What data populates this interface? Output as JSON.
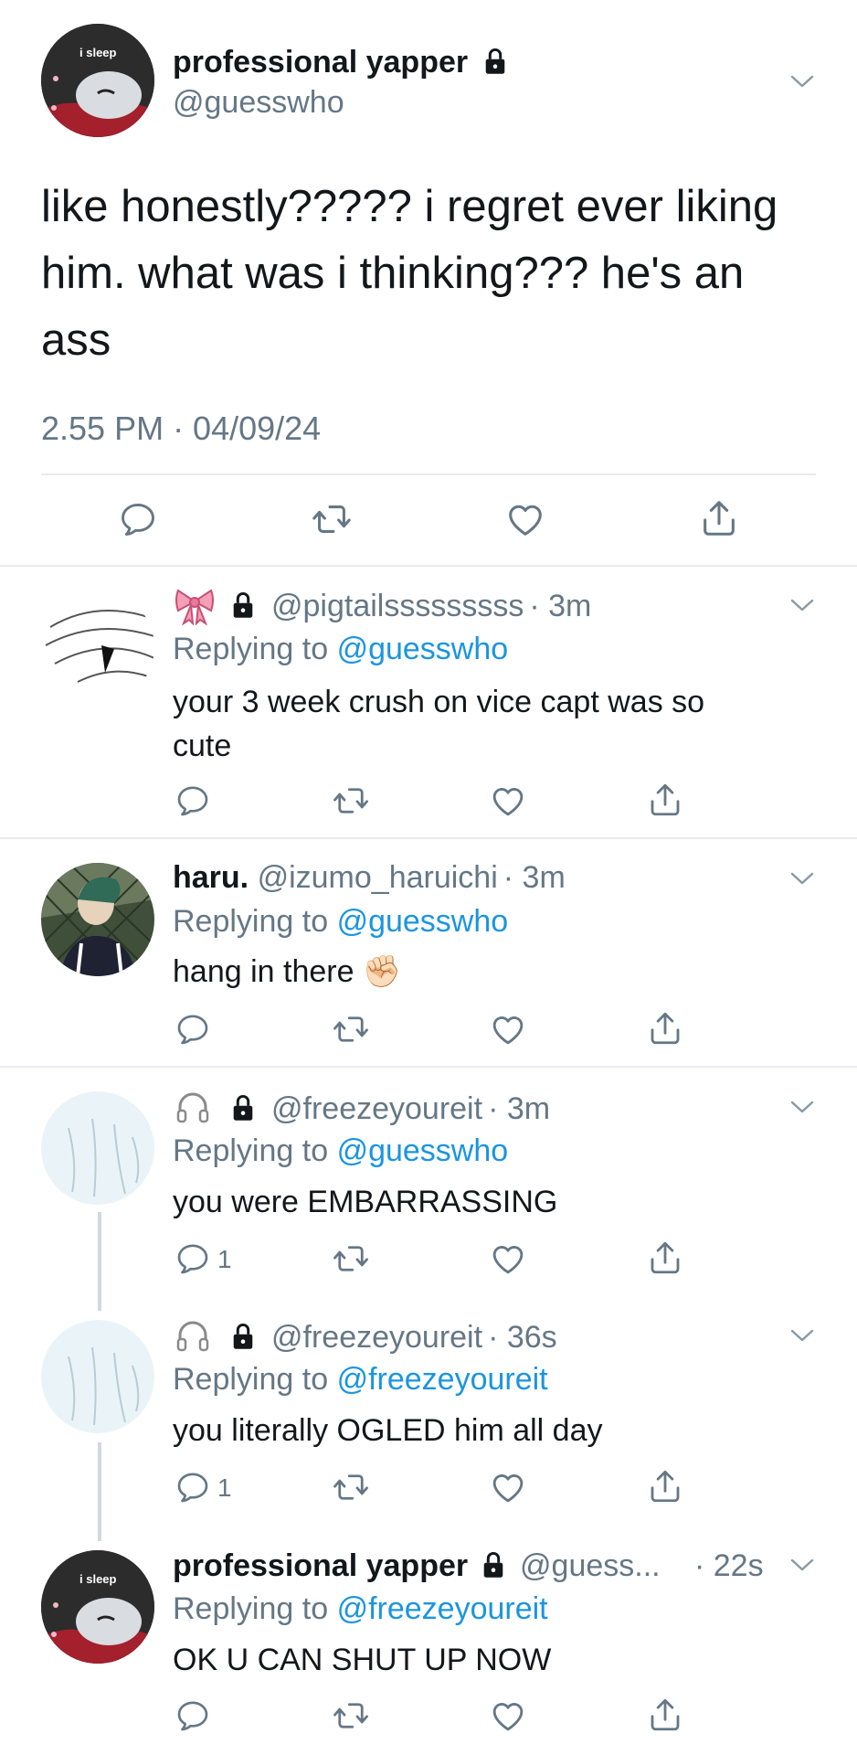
{
  "main": {
    "name": "professional yapper",
    "handle": "@guesswho",
    "text_lines": [
      "like honestly????? i regret ever liking",
      "him. what was i thinking??? he's an",
      "ass"
    ],
    "timestamp": "2.55 PM · 04/09/24",
    "avatar_text": "i sleep"
  },
  "replies": [
    {
      "name": "",
      "handle": "@pigtailsssssssss",
      "time": "· 3m",
      "replying_prefix": "Replying to",
      "replying_to": "@guesswho",
      "text_lines": [
        "your 3 week crush on vice capt was so",
        "cute"
      ],
      "reply_count": ""
    },
    {
      "name": "haru.",
      "handle": "@izumo_haruichi",
      "time": "· 3m",
      "replying_prefix": "Replying to",
      "replying_to": "@guesswho",
      "text_lines": [
        "hang in there ✊🏻"
      ],
      "reply_count": ""
    },
    {
      "name": "",
      "handle": "@freezeyoureit",
      "time": "· 3m",
      "replying_prefix": "Replying to",
      "replying_to": "@guesswho",
      "text_lines": [
        "you were EMBARRASSING"
      ],
      "reply_count": "1"
    },
    {
      "name": "",
      "handle": "@freezeyoureit",
      "time": "· 36s",
      "replying_prefix": "Replying to",
      "replying_to": "@freezeyoureit",
      "text_lines": [
        "you literally OGLED him all day"
      ],
      "reply_count": "1"
    },
    {
      "name": "professional yapper",
      "handle": "@guess...",
      "time": "· 22s",
      "replying_prefix": "Replying to",
      "replying_to": "@freezeyoureit",
      "text_lines": [
        "OK U CAN SHUT UP NOW"
      ],
      "reply_count": "",
      "avatar_text": "i sleep"
    }
  ],
  "icons": [
    "lock-icon",
    "chevron-down-icon",
    "reply-icon",
    "retweet-icon",
    "like-icon",
    "share-icon",
    "bow-icon",
    "headphones-icon",
    "fist-icon"
  ],
  "colors": {
    "link": "#1b95e0",
    "secondary": "#657786",
    "divider": "#e6ecf0",
    "text": "#14171a"
  }
}
